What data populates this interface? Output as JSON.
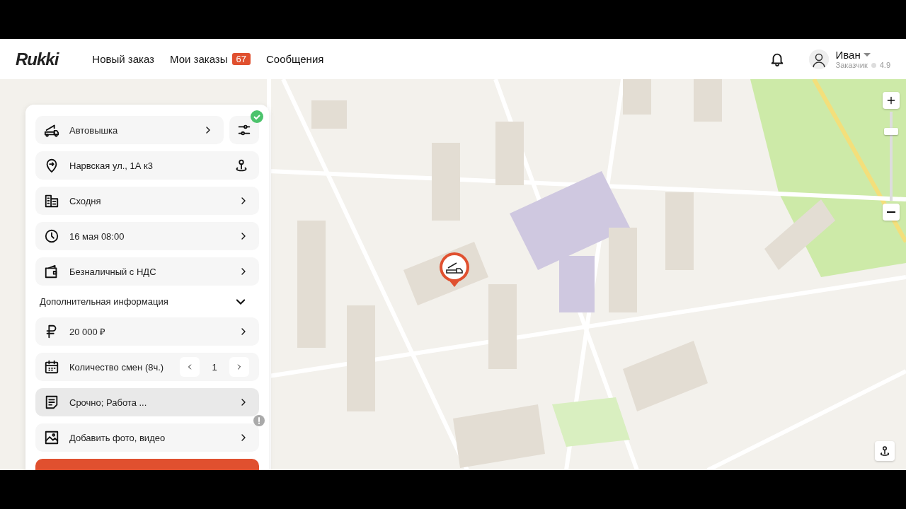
{
  "logo": {
    "text": "Rukki"
  },
  "nav": [
    {
      "label": "Новый заказ"
    },
    {
      "label": "Мои заказы",
      "badge": "67"
    },
    {
      "label": "Сообщения"
    }
  ],
  "user": {
    "name": "Иван",
    "role": "Заказчик",
    "rating": "4.9"
  },
  "map": {
    "zoom": {
      "level": 0.8
    }
  },
  "order_panel": {
    "filter_button": {
      "applied": true
    },
    "rows": [
      {
        "kind": "link",
        "text": "Автовышка",
        "highlighted": false,
        "alert": false
      },
      {
        "kind": "location",
        "text": "Нарвская ул., 1А к3",
        "highlighted": false,
        "alert": false
      },
      {
        "kind": "link",
        "text": "Сходня",
        "highlighted": false,
        "alert": false
      },
      {
        "kind": "link",
        "text": "16 мая 08:00",
        "highlighted": false,
        "alert": false
      },
      {
        "kind": "link",
        "text": "Безналичный с НДС",
        "highlighted": false,
        "alert": false
      },
      {
        "kind": "section",
        "text": "Дополнительная информация",
        "expanded": true
      },
      {
        "kind": "link",
        "text": "20 000 ₽",
        "highlighted": false,
        "alert": false
      },
      {
        "kind": "stepper",
        "text": "Количество смен (8ч.)",
        "value": "1",
        "highlighted": false,
        "alert": false
      },
      {
        "kind": "link",
        "text": "Срочно; Работа ...",
        "highlighted": true,
        "alert": false
      },
      {
        "kind": "link",
        "text": "Добавить фото, видео",
        "highlighted": false,
        "alert": true
      }
    ]
  }
}
